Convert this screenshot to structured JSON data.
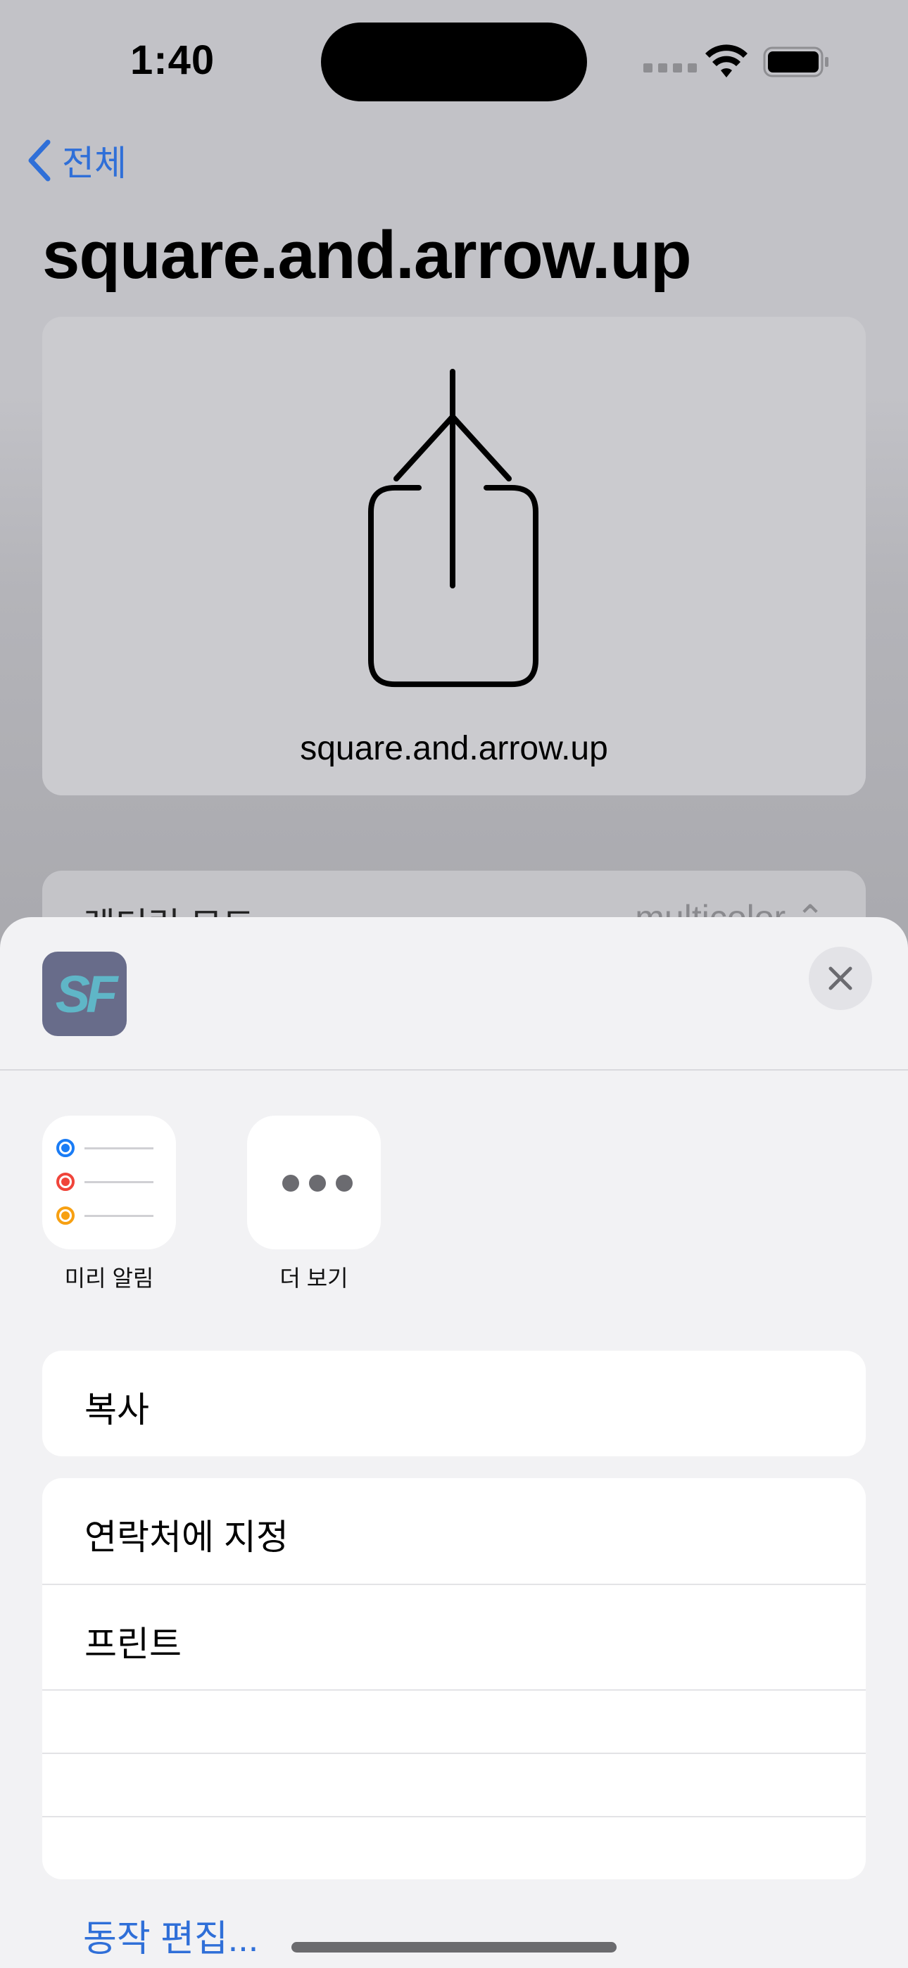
{
  "status_bar": {
    "time": "1:40"
  },
  "nav": {
    "back_label": "전체"
  },
  "page": {
    "title": "square.and.arrow.up",
    "preview_caption": "square.and.arrow.up",
    "render_mode_label": "렌더링 모드",
    "render_mode_value": "multicolor ⌃"
  },
  "share_sheet": {
    "app_icon_text": "SF",
    "apps": [
      {
        "label": "미리 알림",
        "icon": "reminders-icon"
      },
      {
        "label": "더 보기",
        "icon": "more-icon"
      }
    ],
    "actions_group1": [
      {
        "label": "복사"
      }
    ],
    "actions_group2": [
      {
        "label": "연락처에 지정"
      },
      {
        "label": "프린트"
      }
    ],
    "edit_actions_label": "동작 편집..."
  },
  "colors": {
    "accent": "#2f6fd8",
    "reminder_blue": "#1a7cf5",
    "reminder_red": "#f0443a",
    "reminder_orange": "#f7a012"
  }
}
